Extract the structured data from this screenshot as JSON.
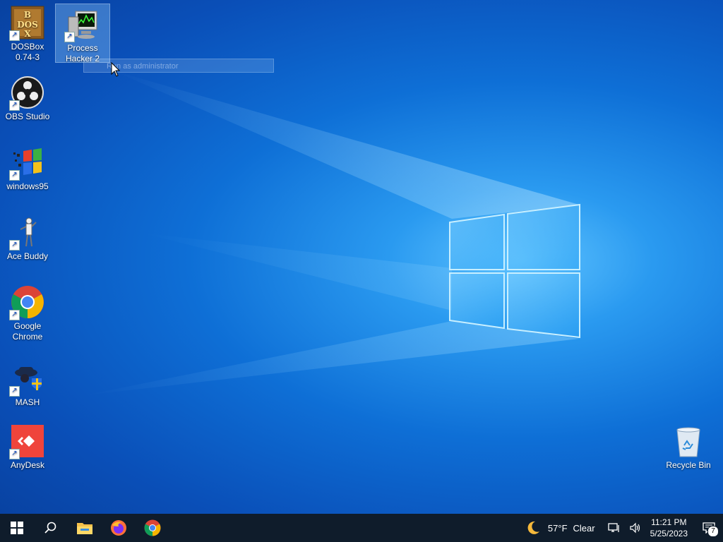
{
  "desktop": {
    "icons": [
      {
        "label": "DOSBox 0.74-3",
        "icon": "dosbox-icon"
      },
      {
        "label": "Process Hacker 2",
        "icon": "process-hacker-icon"
      },
      {
        "label": "OBS Studio",
        "icon": "obs-icon"
      },
      {
        "label": "windows95",
        "icon": "windows95-icon"
      },
      {
        "label": "Ace Buddy",
        "icon": "ace-buddy-icon"
      },
      {
        "label": "Google Chrome",
        "icon": "chrome-icon"
      },
      {
        "label": "MASH",
        "icon": "mash-icon"
      },
      {
        "label": "AnyDesk",
        "icon": "anydesk-icon"
      },
      {
        "label": "Recycle Bin",
        "icon": "recycle-bin-icon"
      }
    ],
    "drag_tooltip": "Run as administrator"
  },
  "taskbar": {
    "pinned": [
      "start-icon",
      "search-icon",
      "file-explorer-icon",
      "firefox-icon",
      "chrome-icon"
    ],
    "weather": {
      "temp": "57°F",
      "condition": "Clear",
      "icon": "moon-icon"
    },
    "clock": {
      "time": "11:21 PM",
      "date": "5/25/2023"
    },
    "notifications": {
      "count": "7"
    }
  },
  "colors": {
    "taskbar": "#0f1c2b",
    "accent": "#0a6fd6"
  }
}
